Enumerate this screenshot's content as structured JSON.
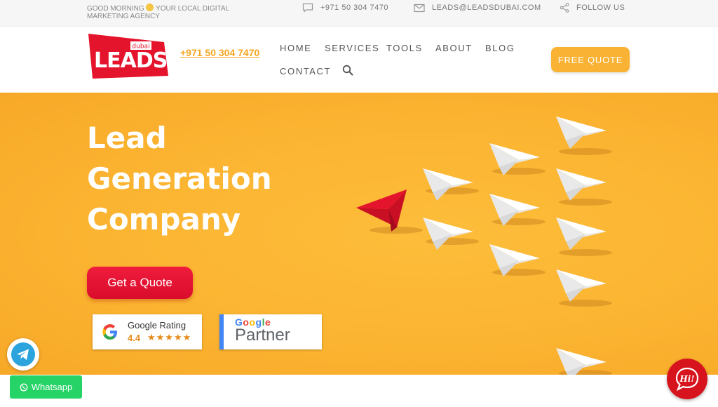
{
  "topbar": {
    "greeting_before": "GOOD MORNING",
    "greeting_after": "YOUR LOCAL DIGITAL MARKETING AGENCY",
    "phone": "+971 50 304 7470",
    "email": "LEADS@LEADSDUBAI.COM",
    "follow": "FOLLOW US"
  },
  "header": {
    "logo_text": "LEADS",
    "logo_sub": "dubai",
    "phone": "+971 50 304 7470",
    "nav": {
      "home": "HOME",
      "services": "SERVICES",
      "tools": "TOOLS",
      "about": "ABOUT",
      "blog": "BLOG",
      "contact": "CONTACT"
    },
    "cta": "FREE QUOTE"
  },
  "hero": {
    "title_lines": [
      "Lead",
      "Generation",
      "Company"
    ],
    "button": "Get a Quote",
    "rating_label": "Google Rating",
    "rating_score": "4.4",
    "rating_stars": "★★★★★",
    "partner_brand": "Google",
    "partner_word": "Partner"
  },
  "widgets": {
    "whatsapp": "Whatsapp",
    "chat": "Hi!"
  },
  "colors": {
    "accent": "#f9b233",
    "hero_bg": "#fbb431",
    "brand_red": "#e4142c",
    "whatsapp": "#25d366"
  },
  "icons": [
    "smile-icon",
    "chat-bubble-icon",
    "mail-icon",
    "share-icon",
    "search-icon",
    "google-g-icon",
    "paper-plane-icon",
    "telegram-icon",
    "whatsapp-icon",
    "hi-chat-icon"
  ]
}
